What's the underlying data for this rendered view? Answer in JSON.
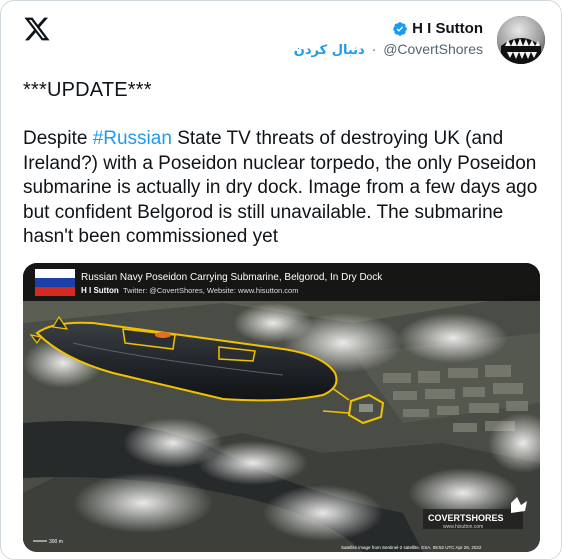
{
  "author": {
    "name": "H I Sutton",
    "follow_label": "دنبال کردن",
    "separator": "·",
    "handle": "@CovertShores"
  },
  "icons": [
    "x-logo-icon",
    "verified-badge-icon"
  ],
  "colors": {
    "link": "#1d9bf0",
    "verified": "#1d9bf0",
    "highlight": "#f2c200"
  },
  "tweet": {
    "update_line": "***UPDATE***",
    "text_before": "Despite ",
    "hashtag": "#Russian",
    "text_after": " State TV threats of destroying UK (and Ireland?) with a Poseidon nuclear torpedo, the only Poseidon submarine is actually in dry dock. Image from a few days ago but confident Belgorod is still unavailable. The submarine hasn't been commissioned yet"
  },
  "media": {
    "title": "Russian Navy Poseidon Carrying Submarine, Belgorod, In Dry Dock",
    "credit_name": "H I Sutton",
    "credit_links": "Twitter: @CovertShores, Website: www.hisutton.com",
    "scale_label": "300 m",
    "logo_text": "COVERTSHORES",
    "logo_sub": "www.hisutton.com",
    "source_note": "Satellite image from Sentinel-2 satellite, ESA. 08:52 UTC Apr 29, 2022"
  }
}
